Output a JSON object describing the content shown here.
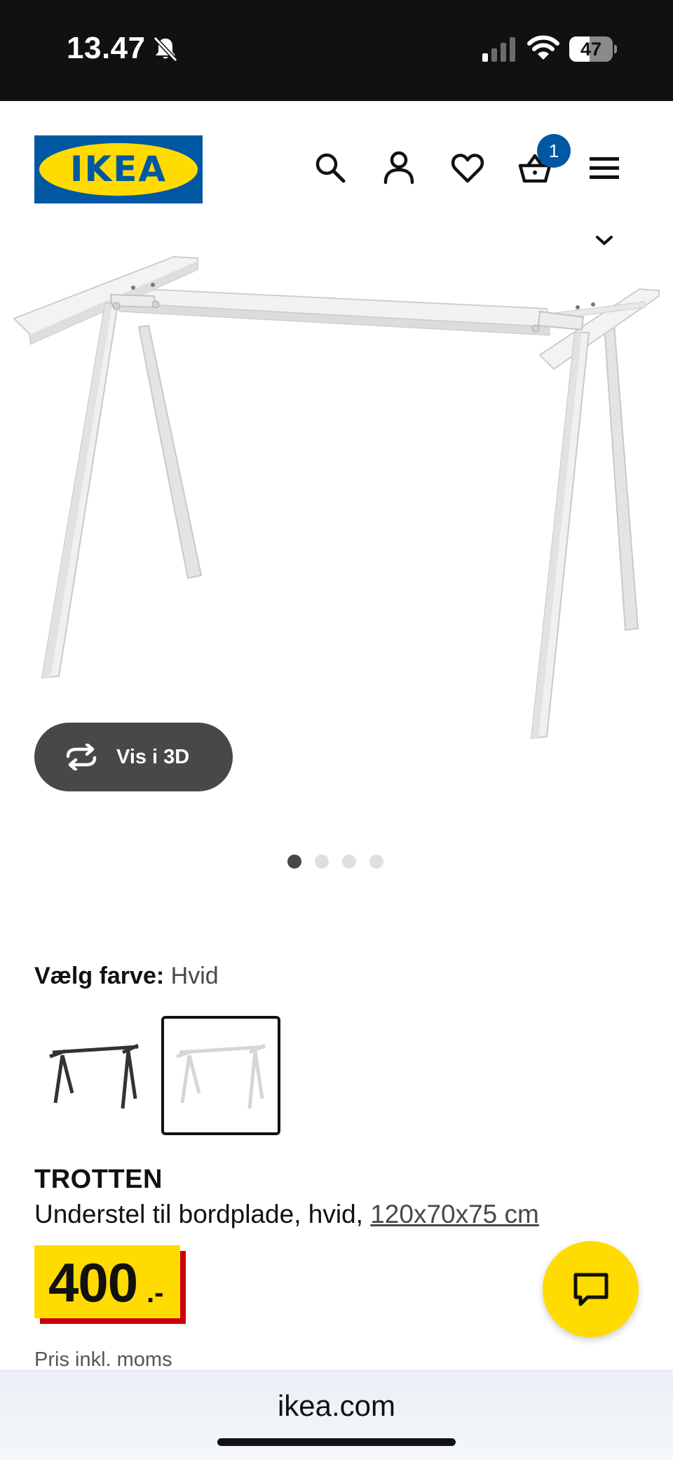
{
  "status_bar": {
    "time": "13.47",
    "battery_text": "47",
    "battery_level": 0.47
  },
  "header": {
    "logo_text": "IKEA",
    "icons": [
      "search-icon",
      "account-icon",
      "heart-icon",
      "basket-icon",
      "menu-icon"
    ],
    "cart_count": "1"
  },
  "gallery": {
    "view_3d_label": "Vis i 3D",
    "image_count": 4,
    "active_index": 0
  },
  "color_select": {
    "label": "Vælg farve:",
    "value": "Hvid",
    "options": [
      "black-frame",
      "white-frame"
    ],
    "selected": "white-frame"
  },
  "product": {
    "name": "TROTTEN",
    "description": "Understel til bordplade, hvid, ",
    "dimensions": "120x70x75 cm",
    "price": "400",
    "price_suffix": ".-",
    "price_note": "Pris inkl. moms"
  },
  "browser": {
    "url": "ikea.com"
  },
  "colors": {
    "ikea_blue": "#0058a3",
    "ikea_yellow": "#ffdb00",
    "price_red": "#cc0008",
    "dark_gray": "#484848"
  }
}
